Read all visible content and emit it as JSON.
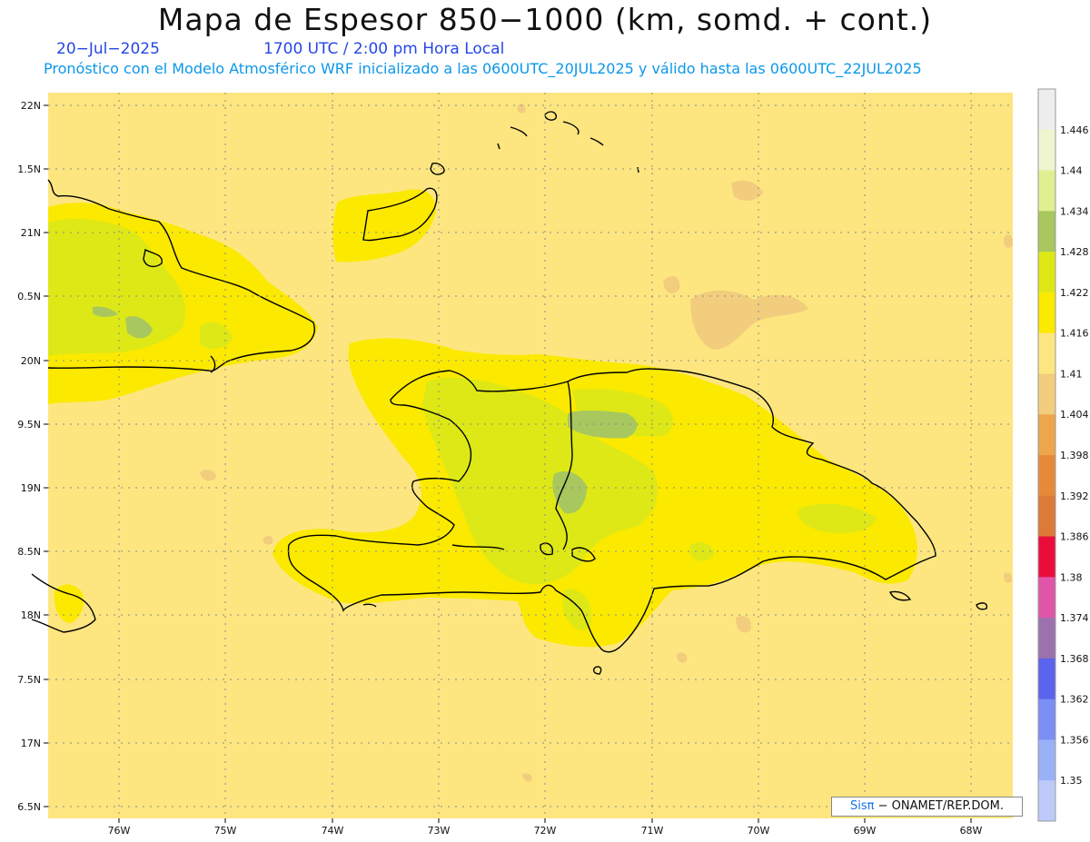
{
  "header": {
    "title": "Mapa de Espesor 850−1000 (km, somd. + cont.)",
    "date": "20−Jul−2025",
    "time": "1700 UTC / 2:00 pm Hora Local",
    "forecast": "Pronóstico con el Modelo Atmosférico WRF inicializado a las 0600UTC_20JUL2025 y válido hasta las  0600UTC_22JUL2025"
  },
  "map": {
    "lat_labels": [
      "22N",
      "1.5N",
      "21N",
      "0.5N",
      "20N",
      "9.5N",
      "19N",
      "8.5N",
      "18N",
      "7.5N",
      "17N",
      "6.5N"
    ],
    "lon_labels": [
      "76W",
      "75W",
      "74W",
      "73W",
      "72W",
      "71W",
      "70W",
      "69W",
      "68W"
    ],
    "colors": {
      "sea": "#fde680",
      "level_1416": "#fbe900",
      "level_1422": "#dde816",
      "level_1428": "#a8c75f",
      "level_1404": "#f2cd7d",
      "coast": "#000000",
      "grid": "#8a8a8a"
    }
  },
  "colorbar": {
    "levels": [
      {
        "label": "1.446",
        "color": "#ededed"
      },
      {
        "label": "1.44",
        "color": "#eff5cf"
      },
      {
        "label": "1.434",
        "color": "#e0f090"
      },
      {
        "label": "1.428",
        "color": "#a8c75f"
      },
      {
        "label": "1.422",
        "color": "#dde816"
      },
      {
        "label": "1.416",
        "color": "#fbe900"
      },
      {
        "label": "1.41",
        "color": "#fde680"
      },
      {
        "label": "1.404",
        "color": "#f2cd7d"
      },
      {
        "label": "1.398",
        "color": "#eea64b"
      },
      {
        "label": "1.392",
        "color": "#e68a3a"
      },
      {
        "label": "1.386",
        "color": "#dd7a38"
      },
      {
        "label": "1.38",
        "color": "#ea0d3c"
      },
      {
        "label": "1.374",
        "color": "#e055a8"
      },
      {
        "label": "1.368",
        "color": "#9b72ad"
      },
      {
        "label": "1.362",
        "color": "#5a64ee"
      },
      {
        "label": "1.356",
        "color": "#7b8ff5"
      },
      {
        "label": "1.35",
        "color": "#9ab1f8"
      },
      {
        "label": "",
        "color": "#bdcafa"
      }
    ]
  },
  "credit": {
    "brand": "Sisπ",
    "text": "− ONAMET/REP.DOM."
  }
}
